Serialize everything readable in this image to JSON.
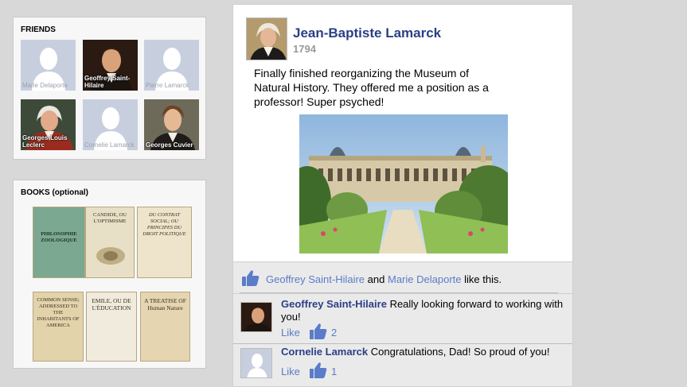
{
  "friends_panel": {
    "title": "FRIENDS",
    "friends": [
      {
        "name": "Marie Delaporte",
        "has_photo": false
      },
      {
        "name": "Geoffrey Saint-Hilaire",
        "has_photo": true
      },
      {
        "name": "Pierre Lamarck",
        "has_photo": false
      },
      {
        "name": "Georges-Louis Leclerc",
        "has_photo": true
      },
      {
        "name": "Cornelie Lamarck",
        "has_photo": false
      },
      {
        "name": "Georges Cuvier",
        "has_photo": true
      }
    ]
  },
  "books_panel": {
    "title": "BOOKS (optional)",
    "books": [
      {
        "title": "PHILOSOPHIE ZOOLOGIQUE"
      },
      {
        "title": "CANDIDE, OU L'OPTIMISME"
      },
      {
        "title": "DU CONTRAT SOCIAL; OU PRINCIPES DU DROIT POLITIQUE"
      },
      {
        "title": "COMMON SENSE; ADDRESSED TO THE INHABITANTS OF AMERICA"
      },
      {
        "title": "EMILE, OU DE L'ÉDUCATION"
      },
      {
        "title": "A TREATISE OF Human Nature"
      }
    ]
  },
  "post": {
    "author": "Jean-Baptiste Lamarck",
    "date": "1794",
    "text": "Finally finished reorganizing the Museum of Natural History. They offered me a position as a professor! Super psyched!"
  },
  "likes": {
    "person1": "Geoffrey Saint-Hilaire",
    "connector": "and",
    "person2": "Marie Delaporte",
    "suffix": "like this."
  },
  "comments": [
    {
      "author": "Geoffrey Saint-Hilaire",
      "text": "Really looking forward to working with you!",
      "like_label": "Like",
      "like_count": "2"
    },
    {
      "author": "Cornelie Lamarck",
      "text": "Congratulations, Dad! So proud of you!",
      "like_label": "Like",
      "like_count": "1"
    }
  ],
  "colors": {
    "author_blue": "#2a3f86",
    "link_blue": "#5b7cc8",
    "background": "#d8d8d8"
  }
}
